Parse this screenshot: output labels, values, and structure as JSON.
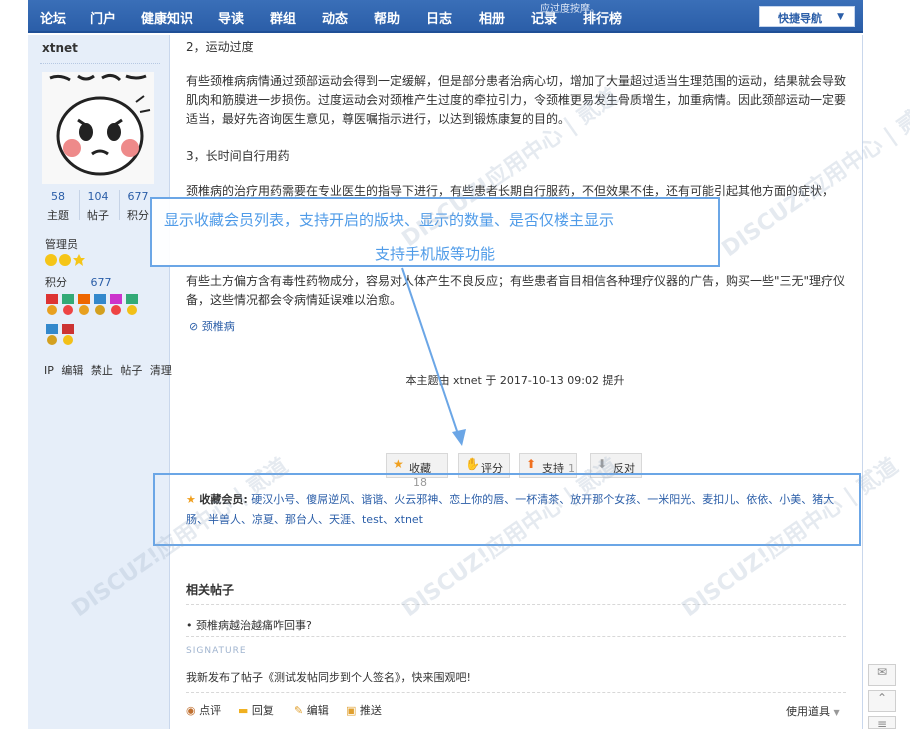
{
  "nav": {
    "items": [
      "论坛",
      "门户",
      "健康知识",
      "导读",
      "群组",
      "动态",
      "帮助",
      "日志",
      "相册",
      "记录",
      "排行榜"
    ],
    "quick_nav": "快捷导航"
  },
  "top_strip_text": "应过度按摩。",
  "user": {
    "name": "xtnet",
    "stats": [
      {
        "num": "58",
        "label": "主题"
      },
      {
        "num": "104",
        "label": "帖子"
      },
      {
        "num": "677",
        "label": "积分"
      }
    ],
    "role": "管理员",
    "score_label": "积分",
    "score_value": "677",
    "admin_links": [
      "IP",
      "编辑",
      "禁止",
      "帖子",
      "清理"
    ]
  },
  "post": {
    "h2": "2，运动过度",
    "p2": "有些颈椎病病情通过颈部运动会得到一定缓解，但是部分患者治病心切，增加了大量超过适当生理范围的运动，结果就会导致肌肉和筋膜进一步损伤。过度运动会对颈椎产生过度的牵拉引力，令颈椎更易发生骨质增生，加重病情。因此颈部运动一定要适当，最好先咨询医生意见，尊医嘱指示进行，以达到锻炼康复的目的。",
    "h3": "3，长时间自行用药",
    "p3": "颈椎病的治疗用药需要在专业医生的指导下进行，有些患者长期自行服药，不但效果不佳，还有可能引起其他方面的症状，",
    "p4": "有些土方偏方含有毒性药物成分，容易对人体产生不良反应；有些患者盲目相信各种理疗仪器的广告，购买一些\"三无\"理疗仪备，这些情况都会令病情延误难以治愈。",
    "tag": "颈椎病",
    "edited": "本主题由 xtnet 于 2017-10-13 09:02 提升"
  },
  "callout": {
    "line1": "显示收藏会员列表，支持开启的版块、显示的数量、是否仅楼主显示",
    "line2": "支持手机版等功能"
  },
  "actions": [
    {
      "label": "收藏",
      "count": "18"
    },
    {
      "label": "评分",
      "count": ""
    },
    {
      "label": "支持",
      "count": "1"
    },
    {
      "label": "反对",
      "count": ""
    }
  ],
  "favorites": {
    "label": "收藏会员:",
    "members": "硬汉小号、傻屌逆风、谐谐、火云邪神、恋上你的唇、一杯清茶、放开那个女孩、一米阳光、麦扣儿、依依、小美、猪大肠、半兽人、凉夏、那台人、天涯、test、xtnet"
  },
  "related": {
    "title": "相关帖子",
    "items": [
      "• 颈椎病越治越痛咋回事?"
    ]
  },
  "signature": {
    "label": "SIGNATURE",
    "text": "我新发布了帖子《测试发帖同步到个人签名》，快来围观吧!"
  },
  "bottom": {
    "items": [
      "点评",
      "回复",
      "编辑",
      "推送"
    ],
    "tools": "使用道具"
  },
  "watermark": "DISCUZ!应用中心 | 贰道"
}
